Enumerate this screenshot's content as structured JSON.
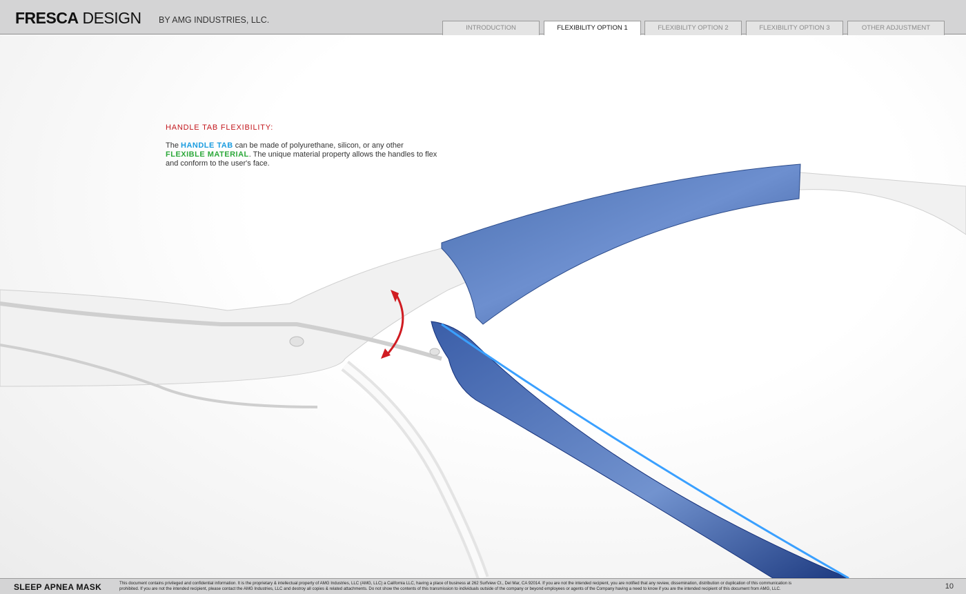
{
  "header": {
    "brand_bold": "FRESCA",
    "brand_light": "DESIGN",
    "byline": "BY AMG INDUSTRIES, LLC."
  },
  "tabs": [
    {
      "label": "INTRODUCTION",
      "active": false
    },
    {
      "label": "FLEXIBILITY OPTION 1",
      "active": true
    },
    {
      "label": "FLEXIBILITY OPTION 2",
      "active": false
    },
    {
      "label": "FLEXIBILITY OPTION 3",
      "active": false
    },
    {
      "label": "OTHER ADJUSTMENT",
      "active": false
    }
  ],
  "content": {
    "heading": "HANDLE TAB FLEXIBILITY:",
    "p1": "The ",
    "handle_tab": "HANDLE TAB",
    "p2": " can be made of polyurethane, silicon, or any other ",
    "flexible_material": "FLEXIBLE MATERIAL",
    "p3": ". The unique material property allows the handles to flex and conform to the user's face."
  },
  "colors": {
    "heading": "#c3161c",
    "handle_tab": "#1a9ce0",
    "flexible_material": "#2ca83a",
    "handle": "#2a5fc8",
    "arrow": "#d01c22"
  },
  "footer": {
    "title": "SLEEP APNEA MASK",
    "legal_1": "This document contains privileged and confidential information. It is the proprietary & intellectual property of AMG Industries, LLC (AMG, LLC) a California LLC, having a place of business at 262 Surfview Ct., Del Mar, CA 92014. If you are not the intended recipient, you are notified that any review, dissemination, distribution or duplication of this communication is",
    "legal_2": "prohibited. If you are not the intended recipient, please contact the AMG Industries, LLC and destroy all copies & related attachments. Do not show the contents of this transmission to individuals outside of the company or beyond employees or agents of the Company having a need to know if you are the intended recipient of this document from AMG, LLC.",
    "page": "10"
  }
}
